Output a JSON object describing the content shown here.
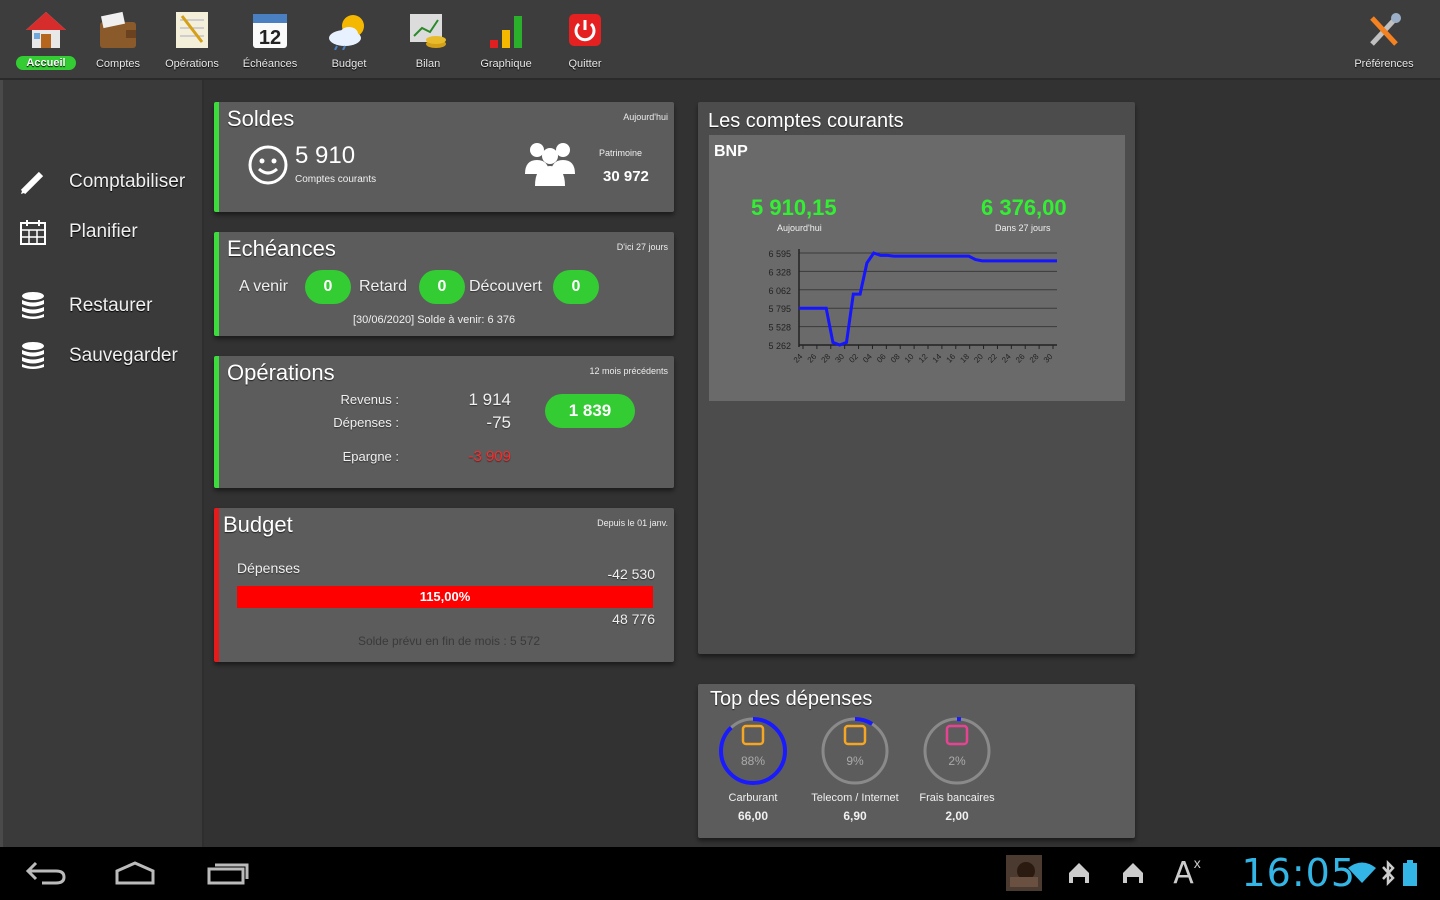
{
  "toolbar": {
    "items": [
      {
        "label": "Accueil",
        "icon": "home-icon"
      },
      {
        "label": "Comptes",
        "icon": "wallet-icon"
      },
      {
        "label": "Opérations",
        "icon": "notepad-icon"
      },
      {
        "label": "Échéances",
        "icon": "calendar-icon"
      },
      {
        "label": "Budget",
        "icon": "weather-icon"
      },
      {
        "label": "Bilan",
        "icon": "bilan-icon"
      },
      {
        "label": "Graphique",
        "icon": "bar-chart-icon"
      },
      {
        "label": "Quitter",
        "icon": "power-icon"
      }
    ],
    "preferences": {
      "label": "Préférences",
      "icon": "tools-icon"
    },
    "active_index": 0,
    "active_color": "#33cc33"
  },
  "sidebar": {
    "items": [
      {
        "label": "Comptabiliser",
        "icon": "pencil-icon"
      },
      {
        "label": "Planifier",
        "icon": "calendar-grid-icon"
      },
      {
        "label": "Restaurer",
        "icon": "database-icon"
      },
      {
        "label": "Sauvegarder",
        "icon": "database-icon"
      }
    ]
  },
  "soldes": {
    "title": "Soldes",
    "subtitle": "Aujourd'hui",
    "amount": "5 910",
    "amount_caption": "Comptes courants",
    "patrimoine_label": "Patrimoine",
    "patrimoine_value": "30 972"
  },
  "echeances": {
    "title": "Echéances",
    "subtitle": "D'ici 27 jours",
    "a_venir_label": "A venir",
    "a_venir_value": "0",
    "retard_label": "Retard",
    "retard_value": "0",
    "decouvert_label": "Découvert",
    "decouvert_value": "0",
    "footer": "[30/06/2020]  Solde à venir: 6 376"
  },
  "operations": {
    "title": "Opérations",
    "subtitle": "12 mois précédents",
    "revenus_label": "Revenus :",
    "revenus_value": "1 914",
    "depenses_label": "Dépenses :",
    "depenses_value": "-75",
    "epargne_label": "Epargne :",
    "epargne_value": "-3 909",
    "total": "1 839"
  },
  "budget": {
    "title": "Budget",
    "subtitle": "Depuis le 01 janv.",
    "depenses_label": "Dépenses",
    "depenses_value": "-42 530",
    "bar_label": "115,00%",
    "progress": 1.0,
    "budget_value": "48 776",
    "footer": "Solde prévu en fin de mois : 5 572",
    "bar_color": "#ff0000"
  },
  "comptes_courants": {
    "title": "Les comptes courants",
    "account": "BNP",
    "today_value": "5 910,15",
    "today_caption": "Aujourd'hui",
    "future_value": "6 376,00",
    "future_caption": "Dans 27 jours",
    "value_color": "#33ee33"
  },
  "chart_data": {
    "type": "line",
    "series": [
      {
        "values": [
          5795,
          5795,
          5795,
          5795,
          5795,
          5300,
          5262,
          5300,
          6000,
          6000,
          6450,
          6595,
          6560,
          6560,
          6550,
          6550,
          6550,
          6550,
          6550,
          6550,
          6550,
          6550,
          6550,
          6550,
          6550,
          6550,
          6500,
          6480,
          6480,
          6480,
          6480,
          6480,
          6480,
          6480,
          6480,
          6480,
          6480,
          6480,
          6480
        ]
      }
    ],
    "x_tick_labels": [
      "24",
      "26",
      "28",
      "30",
      "02",
      "04",
      "06",
      "08",
      "10",
      "12",
      "14",
      "16",
      "18",
      "20",
      "22",
      "24",
      "26",
      "28",
      "30"
    ],
    "y_ticks": [
      "6 595",
      "6 328",
      "6 062",
      "5 795",
      "5 528",
      "5 262"
    ],
    "ylim": [
      5262,
      6595
    ],
    "line_color": "#1515ff",
    "grid": true
  },
  "top_depenses": {
    "title": "Top des dépenses",
    "items": [
      {
        "pct": "88%",
        "fraction": 0.88,
        "category": "Carburant",
        "value": "66,00",
        "icon": "cloud-icon"
      },
      {
        "pct": "9%",
        "fraction": 0.09,
        "category": "Telecom / Internet",
        "value": "6,90",
        "icon": "phone-bill-icon"
      },
      {
        "pct": "2%",
        "fraction": 0.02,
        "category": "Frais bancaires",
        "value": "2,00",
        "icon": "bank-icon"
      }
    ],
    "ring_color": "#1a1aff"
  },
  "statusbar": {
    "time": "16:05",
    "icons": [
      "back-icon",
      "home-nav-icon",
      "recent-apps-icon",
      "thumbnail-icon",
      "download-icon",
      "download-icon",
      "text-size-icon",
      "wifi-icon",
      "bluetooth-icon",
      "battery-icon"
    ]
  }
}
